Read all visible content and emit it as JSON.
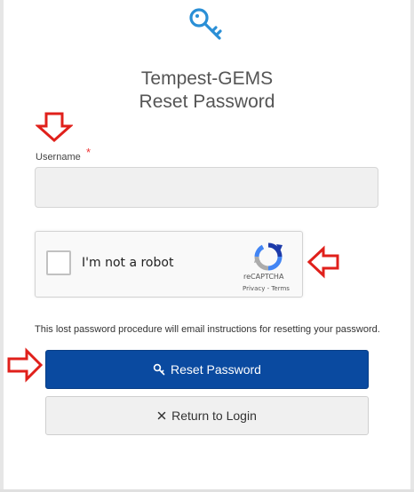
{
  "header": {
    "title_line1": "Tempest-GEMS",
    "title_line2": "Reset Password",
    "icon": "key-icon"
  },
  "form": {
    "username_label": "Username",
    "required_marker": "*",
    "username_value": "",
    "username_placeholder": ""
  },
  "captcha": {
    "label": "I'm not a robot",
    "brand": "reCAPTCHA",
    "links": "Privacy - Terms",
    "checked": false
  },
  "info_text": "This lost password procedure will email instructions for resetting your password.",
  "buttons": {
    "reset_label": "Reset Password",
    "reset_icon": "key-icon",
    "login_label": "Return to Login",
    "login_icon": "close-icon"
  },
  "colors": {
    "accent_icon": "#2a8fd6",
    "primary_button": "#0a4aa0",
    "annotation_arrow": "#e0201b",
    "required_marker": "#ee3333"
  }
}
